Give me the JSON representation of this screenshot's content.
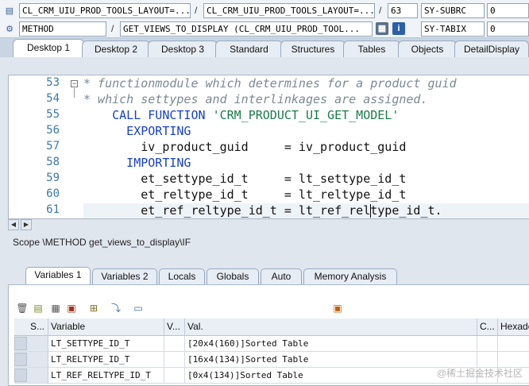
{
  "status": {
    "row1": {
      "field1": "CL_CRM_UIU_PROD_TOOLS_LAYOUT=...",
      "field2": "CL_CRM_UIU_PROD_TOOLS_LAYOUT=...",
      "line": "63",
      "sysvar": "SY-SUBRC",
      "sysval": "0"
    },
    "row2": {
      "field1": "METHOD",
      "field2": "GET_VIEWS_TO_DISPLAY (CL_CRM_UIU_PROD_TOOL...",
      "sysvar": "SY-TABIX",
      "sysval": "0"
    },
    "separator": "/"
  },
  "desktop_tabs": [
    "Desktop 1",
    "Desktop 2",
    "Desktop 3",
    "Standard",
    "Structures",
    "Tables",
    "Objects",
    "DetailDisplay"
  ],
  "editor": {
    "line_numbers": [
      "53",
      "54",
      "55",
      "56",
      "57",
      "58",
      "59",
      "60",
      "61"
    ],
    "lines": [
      {
        "cls": "cmt",
        "text": "* functionmodule which determines for a product guid"
      },
      {
        "cls": "cmt",
        "text": "* which settypes and interlinkages are assigned."
      },
      {
        "parts": [
          {
            "cls": "kw",
            "text": "    CALL FUNCTION "
          },
          {
            "cls": "str",
            "text": "'CRM_PRODUCT_UI_GET_MODEL'"
          }
        ]
      },
      {
        "cls": "kw",
        "text": "      EXPORTING"
      },
      {
        "cls": "plain",
        "text": "        iv_product_guid     = iv_product_guid"
      },
      {
        "cls": "kw",
        "text": "      IMPORTING"
      },
      {
        "cls": "plain",
        "text": "        et_settype_id_t     = lt_settype_id_t"
      },
      {
        "cls": "plain",
        "text": "        et_reltype_id_t     = lt_reltype_id_t"
      },
      {
        "cls": "plain",
        "text": "        et_ref_reltype_id_t = lt_ref_reltype_id_t."
      }
    ]
  },
  "scope_text": "Scope \\METHOD get_views_to_display\\IF",
  "var_tabs": [
    "Variables 1",
    "Variables 2",
    "Locals",
    "Globals",
    "Auto",
    "Memory Analysis"
  ],
  "grid": {
    "headers": [
      "S...",
      "Variable",
      "V...",
      "Val.",
      "C...",
      "Hexade"
    ],
    "rows": [
      {
        "variable": "LT_SETTYPE_ID_T",
        "value": "[20x4(160)]Sorted Table"
      },
      {
        "variable": "LT_RELTYPE_ID_T",
        "value": "[16x4(134)]Sorted Table"
      },
      {
        "variable": "LT_REF_RELTYPE_ID_T",
        "value": "[0x4(134)]Sorted Table"
      }
    ]
  },
  "watermark": "@稀土掘金技术社区"
}
